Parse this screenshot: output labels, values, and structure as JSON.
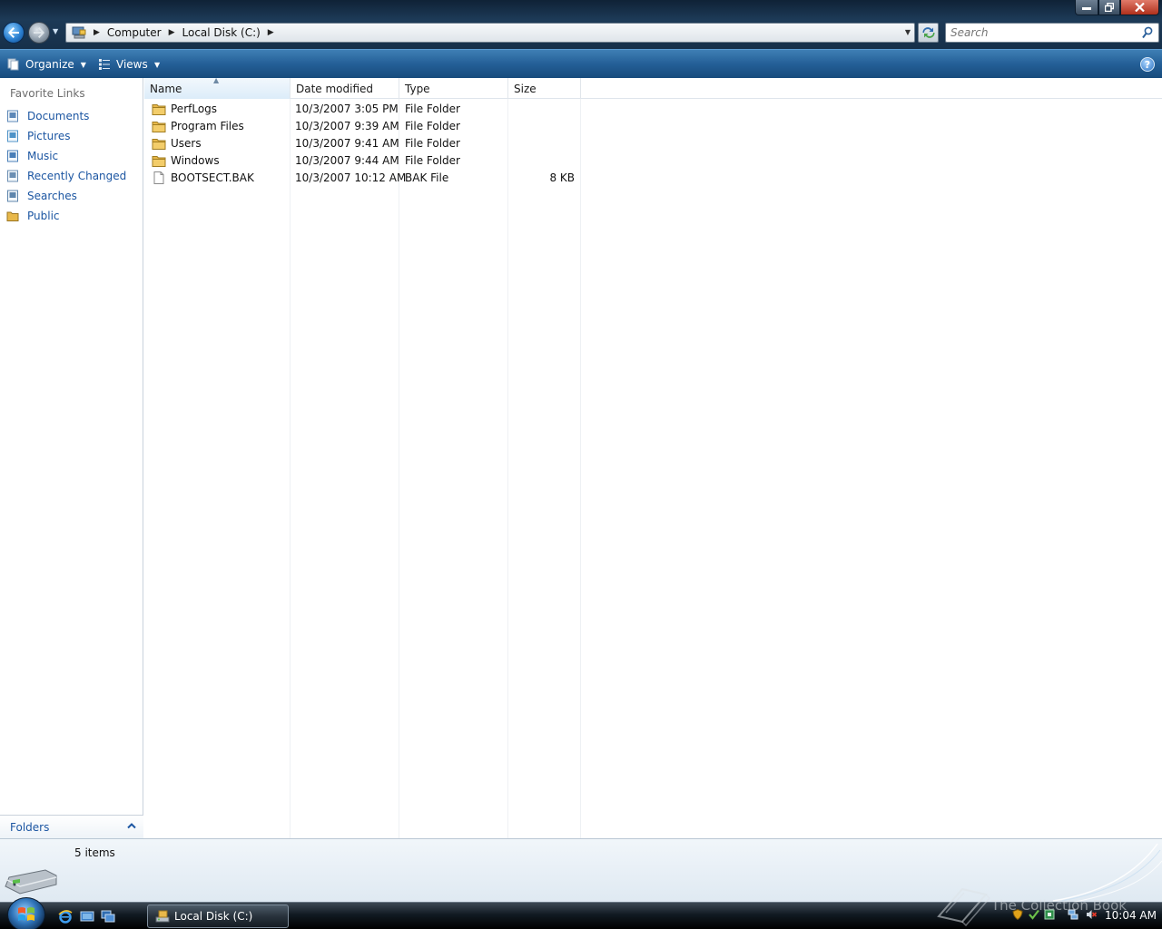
{
  "address": {
    "crumbs": [
      "Computer",
      "Local Disk (C:)"
    ]
  },
  "search": {
    "placeholder": "Search"
  },
  "commands": {
    "organize": "Organize",
    "views": "Views"
  },
  "nav": {
    "title": "Favorite Links",
    "items": [
      {
        "label": "Documents",
        "icon": "documents-icon"
      },
      {
        "label": "Pictures",
        "icon": "pictures-icon"
      },
      {
        "label": "Music",
        "icon": "music-icon"
      },
      {
        "label": "Recently Changed",
        "icon": "recently-changed-icon"
      },
      {
        "label": "Searches",
        "icon": "searches-icon"
      },
      {
        "label": "Public",
        "icon": "public-folder-icon"
      }
    ],
    "folders_label": "Folders"
  },
  "columns": {
    "name": "Name",
    "date": "Date modified",
    "type": "Type",
    "size": "Size"
  },
  "files": [
    {
      "name": "PerfLogs",
      "date": "10/3/2007 3:05 PM",
      "type": "File Folder",
      "size": "",
      "icon": "folder-icon"
    },
    {
      "name": "Program Files",
      "date": "10/3/2007 9:39 AM",
      "type": "File Folder",
      "size": "",
      "icon": "folder-icon"
    },
    {
      "name": "Users",
      "date": "10/3/2007 9:41 AM",
      "type": "File Folder",
      "size": "",
      "icon": "folder-icon"
    },
    {
      "name": "Windows",
      "date": "10/3/2007 9:44 AM",
      "type": "File Folder",
      "size": "",
      "icon": "folder-icon"
    },
    {
      "name": "BOOTSECT.BAK",
      "date": "10/3/2007 10:12 AM",
      "type": "BAK File",
      "size": "8 KB",
      "icon": "file-icon"
    }
  ],
  "details": {
    "count": "5 items"
  },
  "taskbar": {
    "task_label": "Local Disk (C:)",
    "clock": "10:04 AM",
    "watermark": "The Collection Book"
  },
  "colors": {
    "link": "#1c56a2",
    "cmdbar": "#245f97",
    "folder": "#e8b84a"
  }
}
